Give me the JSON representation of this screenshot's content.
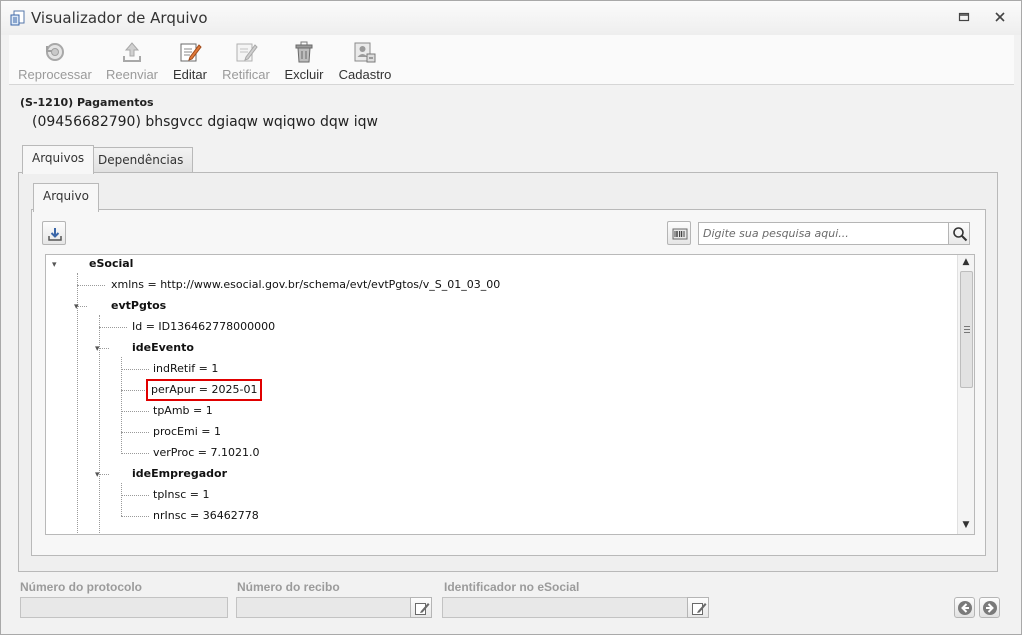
{
  "window": {
    "title": "Visualizador de Arquivo"
  },
  "toolbar": {
    "reprocessar": "Reprocessar",
    "reenviar": "Reenviar",
    "editar": "Editar",
    "retificar": "Retificar",
    "excluir": "Excluir",
    "cadastro": "Cadastro"
  },
  "header": {
    "title": "(S-1210) Pagamentos",
    "subtitle": "(09456682790) bhsgvcc dgiaqw wqiqwo dqw iqw"
  },
  "tabs": {
    "arquivos": "Arquivos",
    "dependencias": "Dependências",
    "arquivo": "Arquivo"
  },
  "search": {
    "placeholder": "Digite sua pesquisa aqui..."
  },
  "tree": {
    "esocial": "eSocial",
    "xmlns": "xmlns = http://www.esocial.gov.br/schema/evt/evtPgtos/v_S_01_03_00",
    "evtPgtos": "evtPgtos",
    "id": "Id = ID136462778000000",
    "ideEvento": "ideEvento",
    "indRetif": "indRetif = 1",
    "perApur": "perApur = 2025-01",
    "tpAmb": "tpAmb = 1",
    "procEmi": "procEmi = 1",
    "verProc": "verProc = 7.1021.0",
    "ideEmpregador": "ideEmpregador",
    "tpInsc": "tpInsc = 1",
    "nrInsc": "nrInsc = 36462778"
  },
  "footer": {
    "protocolo_label": "Número do protocolo",
    "recibo_label": "Número do recibo",
    "identificador_label": "Identificador no eSocial",
    "protocolo_value": "",
    "recibo_value": "",
    "identificador_value": ""
  },
  "colors": {
    "highlight": "#e00000",
    "disabled_text": "#9a9a9a"
  },
  "icons": {
    "app": "file-viewer-icon",
    "reprocessar": "refresh-gear-icon",
    "reenviar": "upload-icon",
    "editar": "edit-pencil-icon",
    "retificar": "edit-pencil-icon",
    "excluir": "trash-icon",
    "cadastro": "user-record-icon",
    "download": "download-icon",
    "barcode": "barcode-icon",
    "search": "magnifier-icon"
  }
}
